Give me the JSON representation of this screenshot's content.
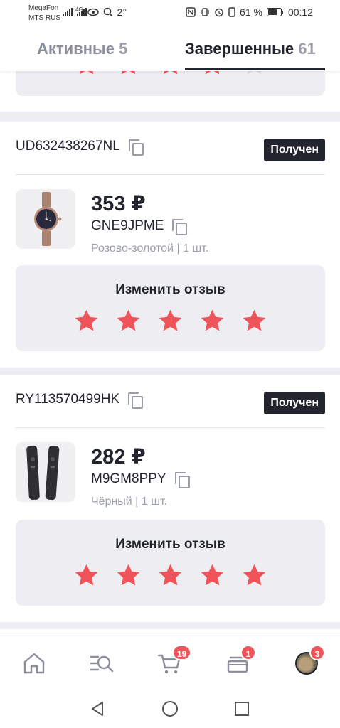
{
  "status_bar": {
    "carrier1": "MegaFon",
    "carrier2": "MTS RUS",
    "network": "4G",
    "temperature": "2°",
    "battery": "61 %",
    "time": "00:12"
  },
  "tabs": {
    "active_label": "Активные",
    "active_count": "5",
    "done_label": "Завершенные",
    "done_count": "61"
  },
  "orders": [
    {
      "track": "UD632438267NL",
      "status": "Получен",
      "price": "353 ₽",
      "sku": "GNE9JPME",
      "variant": "Розово-золотой | 1 шт.",
      "review_label": "Изменить отзыв",
      "rating": 5
    },
    {
      "track": "RY113570499HK",
      "status": "Получен",
      "price": "282 ₽",
      "sku": "M9GM8PPY",
      "variant": "Чёрный | 1 шт.",
      "review_label": "Изменить отзыв",
      "rating": 5
    }
  ],
  "previous_card_rating": 4,
  "bottom_nav": {
    "cart_badge": "19",
    "orders_badge": "1",
    "profile_badge": "3"
  },
  "colors": {
    "star_filled": "#f0545b",
    "star_empty": "#d9d9df",
    "accent_dark": "#22242e",
    "badge": "#f0545b"
  }
}
